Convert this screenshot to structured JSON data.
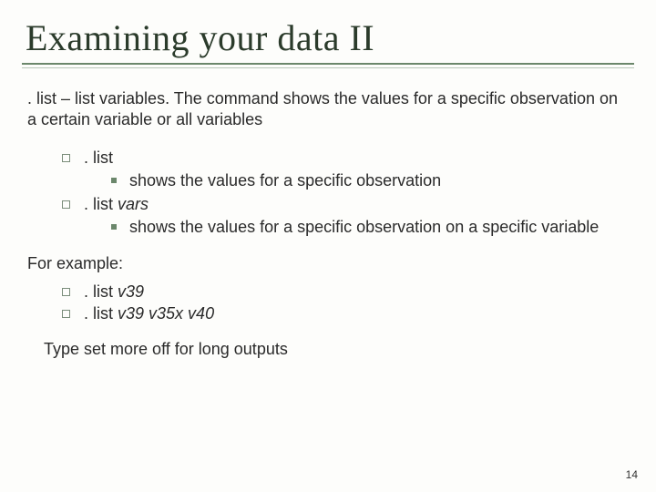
{
  "title": "Examining your data II",
  "intro": {
    "cmd": ". list",
    "sep": " – ",
    "rest": "list variables. The command shows the values for a specific observation on a certain variable or all variables"
  },
  "items": [
    {
      "head": ". list",
      "vars": "",
      "sub": "shows the values for a specific observation"
    },
    {
      "head": ". list ",
      "vars": "vars",
      "sub": "shows the values for a specific observation on a specific variable"
    }
  ],
  "forExample": "For example:",
  "examples": [
    {
      "head": ". list ",
      "vars": "v39"
    },
    {
      "head": ". list ",
      "vars": "v39 v35x v40"
    }
  ],
  "tip": {
    "pre": "Type ",
    "cmd": "set more off",
    "post": " for long outputs"
  },
  "pageNumber": "14"
}
